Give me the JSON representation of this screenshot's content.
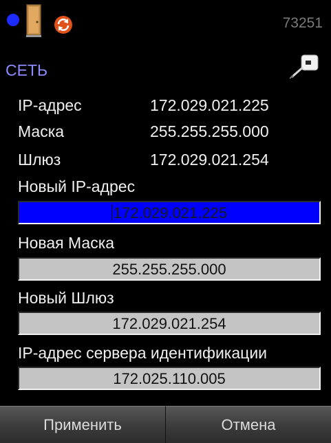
{
  "status": {
    "indicator_icon": "status-dot-icon",
    "door_icon": "door-icon",
    "sync_icon": "sync-icon",
    "counter": "73251"
  },
  "section": {
    "title": "СЕТЬ",
    "settings_icon": "settings-pen-icon"
  },
  "current": {
    "ip_label": "IP-адрес",
    "ip_value": "172.029.021.225",
    "mask_label": "Маска",
    "mask_value": "255.255.255.000",
    "gateway_label": "Шлюз",
    "gateway_value": "172.029.021.254"
  },
  "form": {
    "new_ip_label": "Новый IP-адрес",
    "new_ip_value": "172.029.021.225",
    "new_mask_label": "Новая Маска",
    "new_mask_value": "255.255.255.000",
    "new_gateway_label": "Новый Шлюз",
    "new_gateway_value": "172.029.021.254",
    "auth_server_label": "IP-адрес сервера идентификации",
    "auth_server_value": "172.025.110.005"
  },
  "actions": {
    "apply": "Применить",
    "cancel": "Отмена"
  },
  "colors": {
    "background": "#000000",
    "accent_title": "#8c8cff",
    "active_field": "#0000ff",
    "field_bg": "#c4c4c4"
  }
}
